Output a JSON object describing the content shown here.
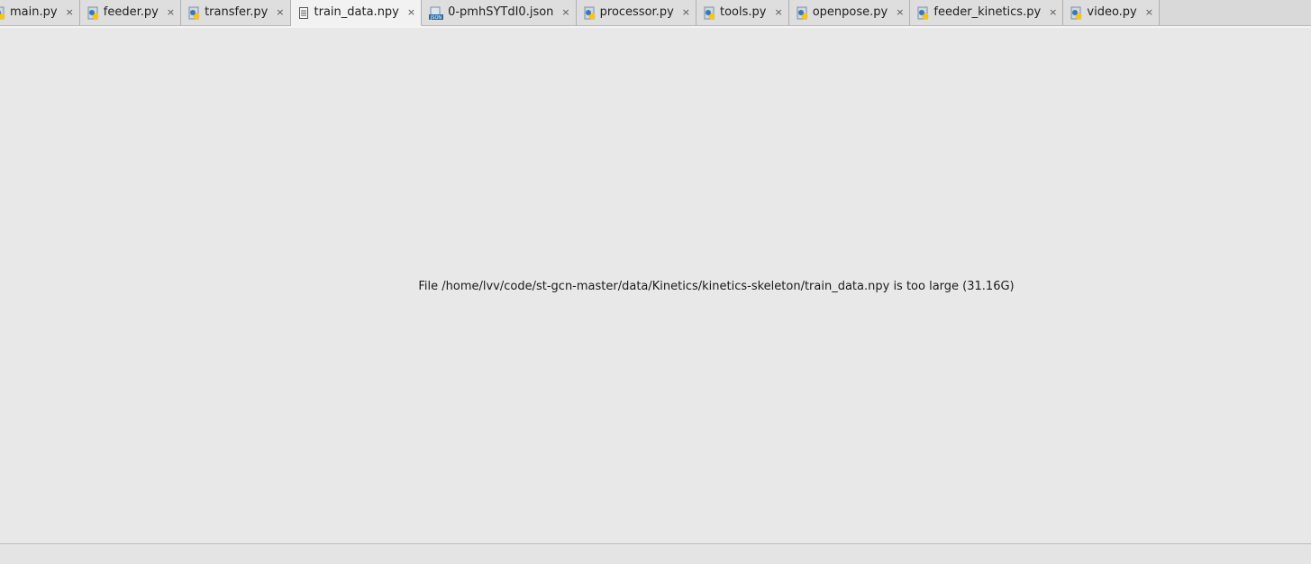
{
  "tabs": [
    {
      "label": "main.py",
      "icon": "python-file-icon",
      "active": false
    },
    {
      "label": "feeder.py",
      "icon": "python-file-icon",
      "active": false
    },
    {
      "label": "transfer.py",
      "icon": "python-file-icon",
      "active": false
    },
    {
      "label": "train_data.npy",
      "icon": "text-file-icon",
      "active": true
    },
    {
      "label": "0-pmhSYTdI0.json",
      "icon": "json-file-icon",
      "active": false
    },
    {
      "label": "processor.py",
      "icon": "python-file-icon",
      "active": false
    },
    {
      "label": "tools.py",
      "icon": "python-file-icon",
      "active": false
    },
    {
      "label": "openpose.py",
      "icon": "python-file-icon",
      "active": false
    },
    {
      "label": "feeder_kinetics.py",
      "icon": "python-file-icon",
      "active": false
    },
    {
      "label": "video.py",
      "icon": "python-file-icon",
      "active": false
    }
  ],
  "close_glyph": "×",
  "editor": {
    "message": "File /home/lvv/code/st-gcn-master/data/Kinetics/kinetics-skeleton/train_data.npy is too large (31.16G)"
  },
  "colors": {
    "python_blue": "#3a77b8",
    "python_yellow": "#f5c518",
    "json_blue": "#2c6aa0"
  }
}
